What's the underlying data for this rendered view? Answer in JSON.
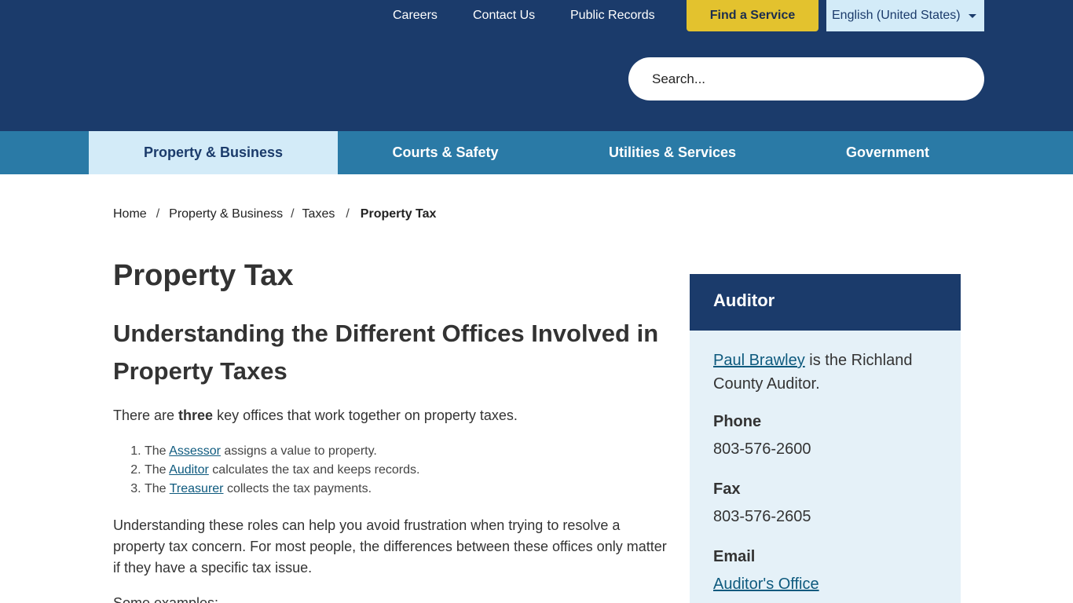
{
  "topbar": {
    "links": [
      "Careers",
      "Contact Us",
      "Public Records"
    ],
    "find_service": "Find a Service",
    "language": "English (United States)"
  },
  "search": {
    "placeholder": "Search..."
  },
  "nav": {
    "items": [
      "Property & Business",
      "Courts & Safety",
      "Utilities & Services",
      "Government"
    ]
  },
  "breadcrumb": {
    "items": [
      "Home",
      "Property & Business",
      "Taxes"
    ],
    "current": "Property Tax"
  },
  "page": {
    "title": "Property Tax",
    "subtitle": "Understanding the Different Offices Involved in Property Taxes",
    "intro_before": "There are ",
    "intro_bold": "three",
    "intro_after": " key offices that work together on property taxes.",
    "list": [
      {
        "before": "The ",
        "link": "Assessor",
        "after": " assigns a value to property."
      },
      {
        "before": "The ",
        "link": "Auditor",
        "after": " calculates the tax and keeps records."
      },
      {
        "before": "The ",
        "link": "Treasurer",
        "after": " collects the tax payments."
      }
    ],
    "paragraph": "Understanding these roles can help you avoid frustration when trying to resolve a property tax concern. For most people, the differences between these offices only matter if they have a specific tax issue.",
    "next_line": "Some examples:"
  },
  "sidebar": {
    "title": "Auditor",
    "person_link": "Paul Brawley",
    "person_text_1": " is the Richland",
    "person_text_2": "County Auditor.",
    "phone_label": "Phone",
    "phone": "803-576-2600",
    "fax_label": "Fax",
    "fax": "803-576-2605",
    "email_label": "Email",
    "email_link": "Auditor's Office"
  }
}
